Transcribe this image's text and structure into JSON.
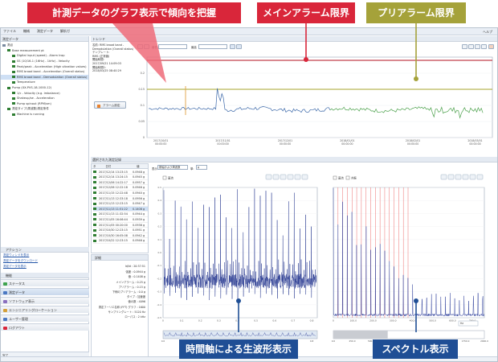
{
  "annotations": {
    "main_caption": "計測データのグラフ表示で傾向を把握",
    "main_alarm": "メインアラーム限界",
    "pre_alarm": "プリアラーム限界",
    "waveform": "時間軸による生波形表示",
    "spectrum": "スペクトル表示"
  },
  "menubar": {
    "items": [
      "ファイル",
      "機械",
      "測定データ",
      "解析ガ"
    ],
    "help": "ヘルプ"
  },
  "left_panel": {
    "header": "測定データ",
    "tree": [
      {
        "label": "測点",
        "level": 0,
        "color": "#7a8aa0"
      },
      {
        "label": "Base measurement pt",
        "level": 1,
        "color": "#2e7d32"
      },
      {
        "label": "Digital input (speed) - Alarm trap",
        "level": 2,
        "color": "#2e7d32"
      },
      {
        "label": "SS (10/16-1 (16Hz) - 1kHz) - Velocity",
        "level": 2,
        "color": "#2e7d32"
      },
      {
        "label": "Peak/peak - Acceleration (High vibration values)",
        "level": 2,
        "color": "#2e7d32"
      },
      {
        "label": "RMS broad band - Acceleration (Overall status)",
        "level": 2,
        "color": "#2e7d32"
      },
      {
        "label": "RMS broad band - Demodulation (Overall status)",
        "level": 2,
        "color": "#2e7d32"
      },
      {
        "label": "Temperature",
        "level": 2,
        "color": "#2e7d32"
      },
      {
        "label": "Pump (XX-PVS-18-1000-12)",
        "level": 1,
        "color": "#2e7d32"
      },
      {
        "label": "1/c - Velocity (e.g. imbalance)",
        "level": 2,
        "color": "#2e7d32"
      },
      {
        "label": "Shakeup/se - Acceleration",
        "level": 2,
        "color": "#2e7d32"
      },
      {
        "label": "Pump spinout (RPM/sm)",
        "level": 2,
        "color": "#2e7d32"
      },
      {
        "label": "測定タイプ(周波数)測定条件",
        "level": 1,
        "color": "#2e7d32"
      },
      {
        "label": "Machine is running",
        "level": 2,
        "color": "#2e7d32"
      }
    ],
    "actions_header": "アクション",
    "action_links": [
      "測定ウィンドを表示",
      "測定データをダウンロード",
      "測定データを表示"
    ],
    "nav_header": "機能",
    "nav_items": [
      {
        "label": "ステータス",
        "color": "#3fa34d"
      },
      {
        "label": "測定データ",
        "color": "#4a78c2"
      },
      {
        "label": "ソフトウェア表示",
        "color": "#8a6fbf"
      },
      {
        "label": "エンジニアリングローケーション",
        "color": "#d4a03a"
      },
      {
        "label": "ユーザー管理",
        "color": "#4a78c2"
      },
      {
        "label": "ログアウト",
        "color": "#d9263a"
      }
    ],
    "status_bar": "完了"
  },
  "trend": {
    "header": "トレンド",
    "info": {
      "measure_point_label": "名前:",
      "measure_point": "RMS broad band - Demodulation (Overall status)",
      "template_label": "テンプレート:",
      "template": "RMS (正常値)",
      "start_label": "開始時間:",
      "start": "2017/09/21 14:09:03",
      "end_label": "開始時間2:",
      "end": "2018/03/25 08:40:29"
    },
    "alarm_button": "アラーム設定",
    "select_a": "最低",
    "select_b": "最高",
    "y_ticks": [
      "0.2",
      "0.15",
      "0.1",
      "0.05",
      "0"
    ],
    "x_ticks": [
      "2017/10/01\n00:00:00",
      "2017/11/01\n00:00:00",
      "2017/12/01\n00:00:00",
      "2018/01/01\n00:00:00",
      "2018/02/01\n00:00:00",
      "2018/03/01\n00:00:00"
    ]
  },
  "lower": {
    "header": "選択された測定記録",
    "list_headers": [
      "タ",
      "日付",
      "値"
    ],
    "list_rows": [
      {
        "date": "2017/12/14 13:23:15",
        "value": "0.0948 g"
      },
      {
        "date": "2017/12/14 13:24:15",
        "value": "0.0945 g"
      },
      {
        "date": "2017/12/06 14:22:17",
        "value": "0.0957 g"
      },
      {
        "date": "2017/12/06 12:22:18",
        "value": "0.0946 g"
      },
      {
        "date": "2017/11/15 12:22:48",
        "value": "0.0940 g"
      },
      {
        "date": "2017/11/13 12:33:18",
        "value": "0.0956 g"
      },
      {
        "date": "2017/11/13 12:23:15",
        "value": "0.0947 g"
      },
      {
        "date": "2017/11/13 11:51:22",
        "value": "0.1408 g"
      },
      {
        "date": "2017/11/13 11:32:54",
        "value": "0.0944 g"
      },
      {
        "date": "2017/11/05 16:06:44",
        "value": "0.0939 g"
      },
      {
        "date": "2017/11/05 00:20:00",
        "value": "0.0936 g"
      },
      {
        "date": "2017/10/30 12:23:15",
        "value": "0.0951 g"
      },
      {
        "date": "2017/10/30 16:05:08",
        "value": "0.0942 g"
      },
      {
        "date": "2017/10/22 12:23:15",
        "value": "0.0946 g"
      }
    ],
    "details_header": "詳細",
    "details": [
      {
        "k": "Id/Id",
        "v": "20:37:51"
      },
      {
        "k": "強度",
        "v": "0.0944 g"
      },
      {
        "k": "値",
        "v": "0.1408 g"
      },
      {
        "k": "メインアラーム",
        "v": "0.25 g"
      },
      {
        "k": "プリアラーム",
        "v": "0.15 g"
      },
      {
        "k": "下側のプリアラーム",
        "v": "0.0 g"
      },
      {
        "k": "タイプ",
        "v": "加速度"
      },
      {
        "k": "値の数",
        "v": "4096"
      },
      {
        "k": "測定フーリエ名称 (FFT) グラフ",
        "v": "1600"
      },
      {
        "k": "サンプリングレート",
        "v": "5120 Hz"
      },
      {
        "k": "ローパス",
        "v": "2 kHz"
      }
    ],
    "wave_mode_label": "表示:",
    "wave_mode": "振幅および周波数",
    "unit_label": "単:",
    "unit": "g",
    "waveform_legend": "直流",
    "spectrum_legend_a": "直流",
    "spectrum_legend_b": "共振",
    "waveform_xticks": [
      "0",
      "0.1",
      "0.2",
      "0.3",
      "0.4",
      "0.5",
      "0.6",
      "0.7",
      "0.8"
    ],
    "spectrum_xticks": [
      "0",
      "100.0",
      "200.0",
      "300.0",
      "400.0",
      "500.0",
      "600.0",
      "700.0"
    ],
    "overview_wave_ticks": [
      "0.0",
      "0.1",
      "0.2",
      "0.3",
      "0.4",
      "0.5",
      "0.6",
      "0.7",
      "0.8"
    ],
    "overview_spec_ticks": [
      "0.0",
      "250.0",
      "500.0",
      "750.0",
      "1000.0",
      "1250.0",
      "1500.0",
      "1750.0",
      "2000.0"
    ],
    "spec_unit": "Hz"
  },
  "colors": {
    "main_alarm": "#b3101f",
    "pre_alarm": "#a7a62c",
    "trend_line": "#3a67a8",
    "trend_green": "#4aa04a",
    "wave": "#24358f",
    "spectrum": "#2a3c9a",
    "spectrum_markers": "#e64a4a"
  }
}
